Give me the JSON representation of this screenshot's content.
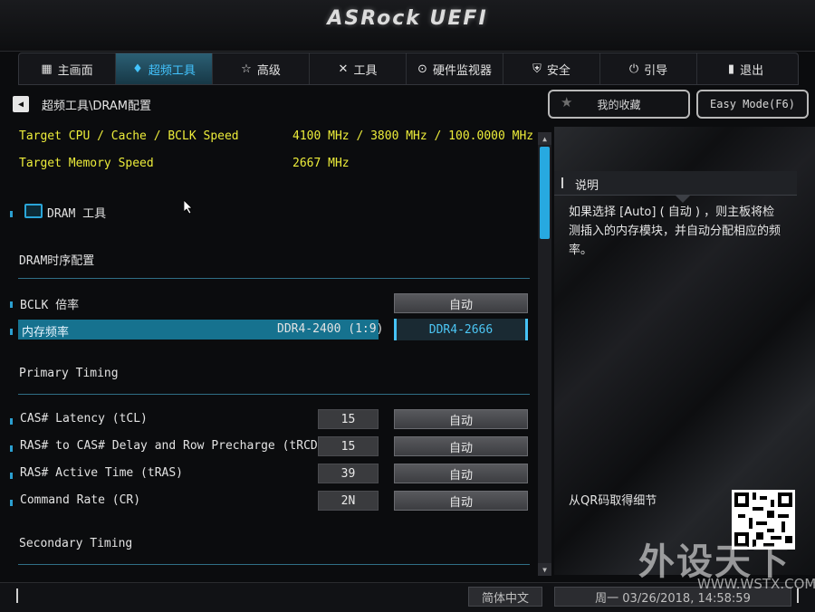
{
  "header": {
    "logo": "ASRock UEFI"
  },
  "tabs": [
    {
      "label": "主画面",
      "icon": "main-icon"
    },
    {
      "label": "超频工具",
      "icon": "oc-flame-icon",
      "active": true
    },
    {
      "label": "高级",
      "icon": "star-icon"
    },
    {
      "label": "工具",
      "icon": "tools-icon"
    },
    {
      "label": "硬件监视器",
      "icon": "monitor-icon"
    },
    {
      "label": "安全",
      "icon": "shield-icon"
    },
    {
      "label": "引导",
      "icon": "power-icon"
    },
    {
      "label": "退出",
      "icon": "exit-icon"
    }
  ],
  "breadcrumb": "超频工具\\DRAM配置",
  "favorites_label": "我的收藏",
  "easy_mode_label": "Easy Mode(F6)",
  "targets": [
    {
      "label": "Target CPU / Cache / BCLK Speed",
      "value": "4100 MHz / 3800 MHz / 100.0000 MHz"
    },
    {
      "label": "Target Memory Speed",
      "value": "2667 MHz"
    }
  ],
  "dram_tool_label": "DRAM 工具",
  "sections": {
    "dram_timing": "DRAM时序配置",
    "primary_timing": "Primary Timing",
    "secondary_timing": "Secondary Timing"
  },
  "bclk_ratio": {
    "label": "BCLK 倍率",
    "button": "自动"
  },
  "mem_freq": {
    "label": "内存频率",
    "current": "DDR4-2400 (1:9)",
    "selected": "DDR4-2666"
  },
  "timings": [
    {
      "label": "CAS# Latency (tCL)",
      "value": "15",
      "button": "自动"
    },
    {
      "label": "RAS# to CAS# Delay and Row Precharge (tRCDtRP)",
      "value": "15",
      "button": "自动"
    },
    {
      "label": "RAS# Active Time (tRAS)",
      "value": "39",
      "button": "自动"
    },
    {
      "label": "Command Rate (CR)",
      "value": "2N",
      "button": "自动"
    }
  ],
  "description": {
    "title": "说明",
    "text": "如果选择 [Auto] ( 自动 ) ，则主板将检测插入的内存模块，并自动分配相应的频率。"
  },
  "qr_label": "从QR码取得细节",
  "watermark": {
    "text": "外设天下",
    "url": "WWW.WSTX.COM"
  },
  "bottom": {
    "language": "简体中文",
    "datetime": "周一 03/26/2018, 14:58:59"
  },
  "colors": {
    "accent": "#27a9e0",
    "highlight_row": "#16728f",
    "target_text": "#ecec3a"
  }
}
